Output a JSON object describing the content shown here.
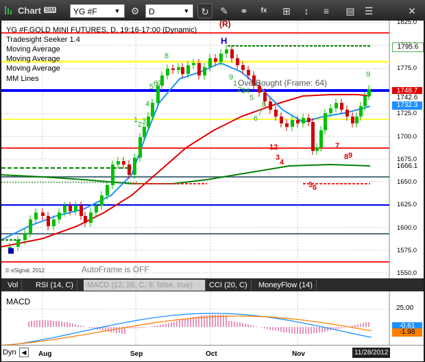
{
  "toolbar": {
    "app_title": "Chart",
    "badge": "SIM",
    "symbol": "YG #F",
    "interval": "D",
    "icons": [
      "symbol-dropdown-icon",
      "settings-icon",
      "interval-dropdown-icon",
      "refresh-icon",
      "draw-pencil-icon",
      "link-icon",
      "fx-icon",
      "bar-style-icon",
      "close-icon"
    ]
  },
  "legend": {
    "line1": "YG #F,GOLD MINI FUTURES, D, 19:16-17:00 (Dynamic)",
    "line2": "Tradesight Seeker 1.4",
    "line3": "Moving Average",
    "line4": "Moving Average",
    "line5": "Moving Average",
    "line6": "MM Lines"
  },
  "annotations": {
    "overbought": "OverBought (Frame: 64)",
    "autoframe": "AutoFrame is OFF",
    "esignal": "© eSignal, 2012",
    "h": "H",
    "r": "(R)"
  },
  "price_axis": [
    "1825.0",
    "1800.0",
    "1775.0",
    "1750.0",
    "1725.0",
    "1700.0",
    "1675.0",
    "1650.0",
    "1625.0",
    "1600.0",
    "1575.0",
    "1550.0"
  ],
  "price_tags": {
    "ma_green_top": "1795.6",
    "last_price": "1748.7",
    "ma_red": "1742.6",
    "ma_blue": "1732.3",
    "ma_green_low": "1666.1"
  },
  "tabs": [
    "Vol",
    "RSI (14, C)",
    "MACD (12, 26, C, 9, false, true)",
    "CCI (20, C)",
    "MoneyFlow (14)"
  ],
  "macd": {
    "label": "MACD",
    "axis": [
      "25.00"
    ],
    "tags": [
      "-0.61",
      "-1.98"
    ]
  },
  "bottom": {
    "dyn": "Dyn",
    "months": [
      "Aug",
      "Sep",
      "Oct",
      "Nov"
    ],
    "date": "11/28/2012"
  },
  "colors": {
    "up_candle": "#00c000",
    "down_candle": "#d00000",
    "ma_blue": "#1e90ff",
    "ma_red": "#e00000",
    "ma_green": "#008000",
    "mm_red": "#ff0000",
    "mm_blue": "#0000ff",
    "mm_yellow": "#ffff33"
  },
  "seeker_labels": {
    "green": [
      "1",
      "2",
      "3",
      "4",
      "5",
      "6",
      "7",
      "8",
      "9",
      "1",
      "2",
      "3",
      "4",
      "5",
      "6",
      "7",
      "8",
      "9",
      "1",
      "2"
    ],
    "red": [
      "1",
      "2",
      "3",
      "4",
      "5",
      "6",
      "7",
      "8",
      "9"
    ]
  }
}
